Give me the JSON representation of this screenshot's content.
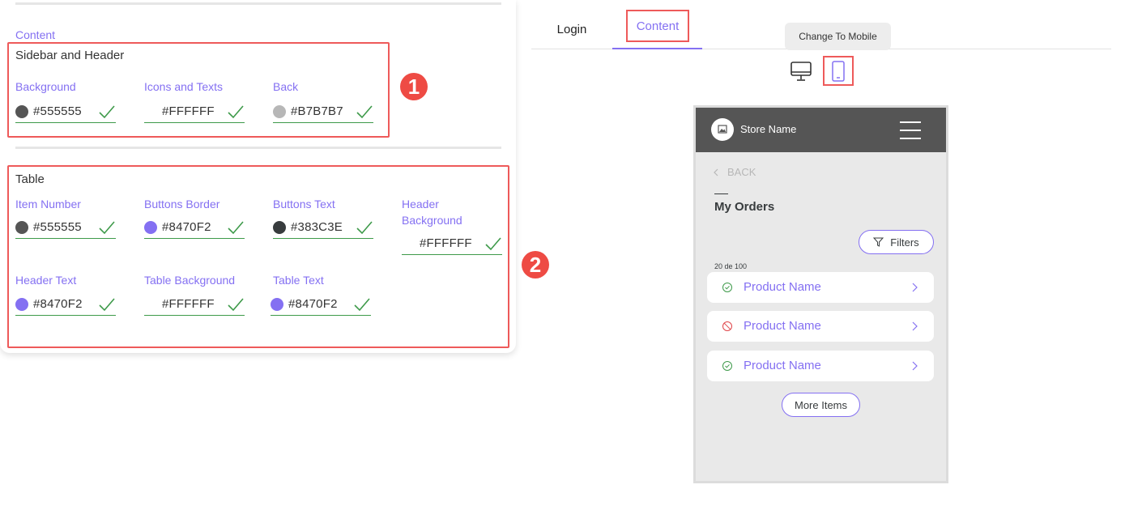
{
  "settings": {
    "content_link": "Content",
    "sidebar_header": {
      "title": "Sidebar and Header",
      "fields": [
        {
          "label": "Background",
          "value": "#555555",
          "swatch": "#555555"
        },
        {
          "label": "Icons and Texts",
          "value": "#FFFFFF",
          "swatch": ""
        },
        {
          "label": "Back",
          "value": "#B7B7B7",
          "swatch": "#B7B7B7"
        }
      ]
    },
    "table": {
      "title": "Table",
      "fields": [
        {
          "label": "Item Number",
          "value": "#555555",
          "swatch": "#555555"
        },
        {
          "label": "Buttons Border",
          "value": "#8470F2",
          "swatch": "#8470F2"
        },
        {
          "label": "Buttons Text",
          "value": "#383C3E",
          "swatch": "#383C3E"
        },
        {
          "label": "Header Background",
          "value": "#FFFFFF",
          "swatch": ""
        },
        {
          "label": "Header Text",
          "value": "#8470F2",
          "swatch": "#8470F2"
        },
        {
          "label": "Table Background",
          "value": "#FFFFFF",
          "swatch": ""
        },
        {
          "label": "Table Text",
          "value": "#8470F2",
          "swatch": "#8470F2"
        }
      ]
    },
    "badges": [
      "1",
      "2"
    ]
  },
  "preview": {
    "tabs": [
      {
        "label": "Login",
        "active": false
      },
      {
        "label": "Content",
        "active": true
      }
    ],
    "tooltip": "Change To Mobile",
    "device_icons": [
      "desktop-icon",
      "mobile-icon"
    ],
    "phone": {
      "store_name": "Store Name",
      "back_label": "BACK",
      "page_title": "My Orders",
      "filters_label": "Filters",
      "count_label": "20 de 100",
      "orders": [
        {
          "name": "Product Name",
          "status": "check-circle-icon"
        },
        {
          "name": "Product Name",
          "status": "blocked-icon"
        },
        {
          "name": "Product Name",
          "status": "check-circle-icon"
        }
      ],
      "more_label": "More Items"
    }
  },
  "colors": {
    "accent": "#8470F2",
    "header_bg": "#555555",
    "highlight": "#EE5A5A",
    "valid_green": "#3E9A4A",
    "blocked_red": "#E0464A"
  }
}
